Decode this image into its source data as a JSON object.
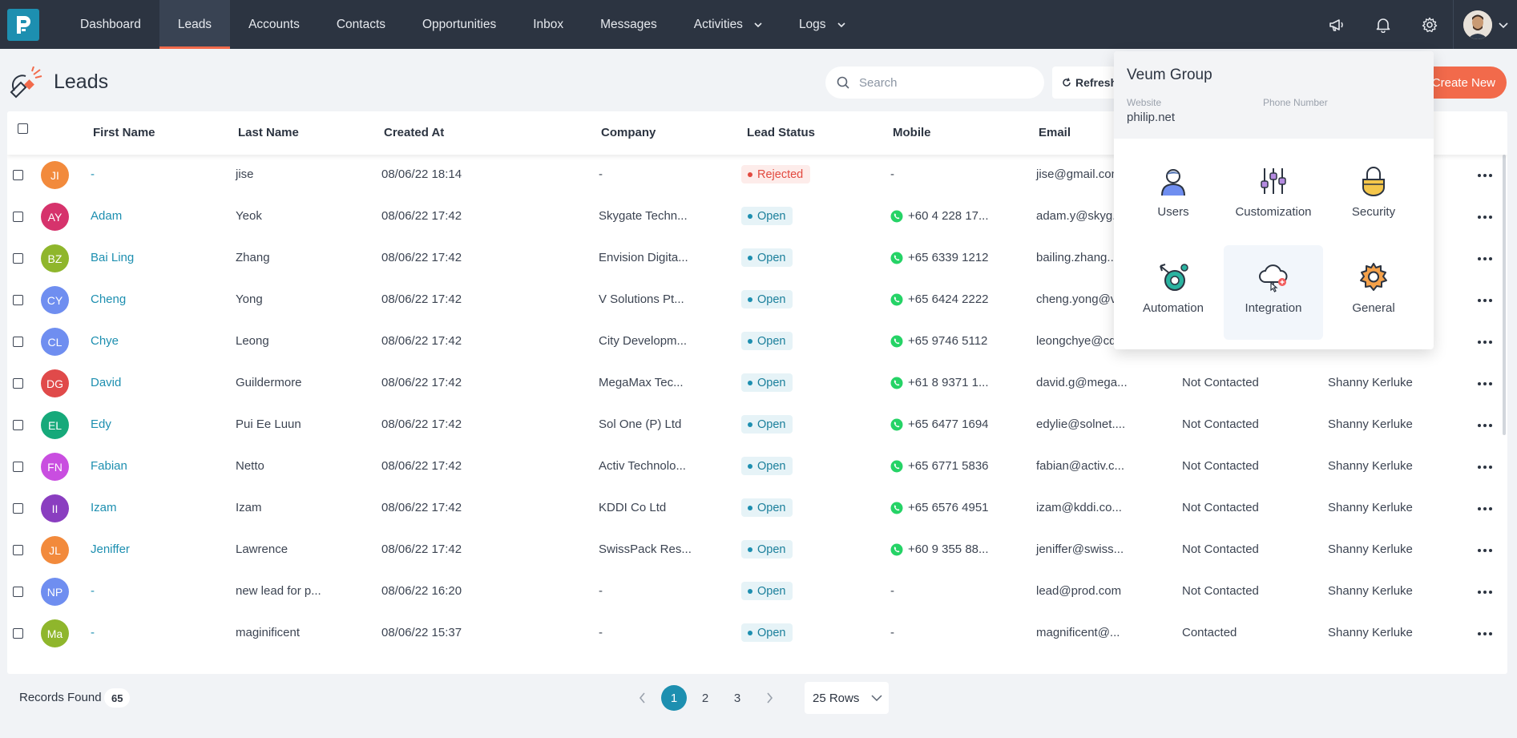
{
  "nav": {
    "items": [
      {
        "label": "Dashboard"
      },
      {
        "label": "Leads",
        "active": true
      },
      {
        "label": "Accounts"
      },
      {
        "label": "Contacts"
      },
      {
        "label": "Opportunities"
      },
      {
        "label": "Inbox"
      },
      {
        "label": "Messages"
      },
      {
        "label": "Activities",
        "dropdown": true
      },
      {
        "label": "Logs",
        "dropdown": true
      }
    ],
    "right_icons": [
      "megaphone-icon",
      "bell-icon",
      "gear-icon"
    ]
  },
  "page": {
    "title": "Leads",
    "search_placeholder": "Search",
    "search_value": "",
    "refresh_label": "Refresh",
    "create_label": "Create New"
  },
  "table": {
    "columns": [
      "First Name",
      "Last Name",
      "Created At",
      "Company",
      "Lead Status",
      "Mobile",
      "Email"
    ],
    "rows": [
      {
        "initials": "JI",
        "color": "#f28a3c",
        "first": "-",
        "last": "jise",
        "created": "08/06/22 18:14",
        "company": "-",
        "status": "Rejected",
        "mobile": "-",
        "wa": false,
        "email": "jise@gmail.com",
        "contact": "",
        "owner": ""
      },
      {
        "initials": "AY",
        "color": "#d6336c",
        "first": "Adam",
        "last": "Yeok",
        "created": "08/06/22 17:42",
        "company": "Skygate Techn...",
        "status": "Open",
        "mobile": "+60 4 228 17...",
        "wa": true,
        "email": "adam.y@skyg...",
        "contact": "",
        "owner": ""
      },
      {
        "initials": "BZ",
        "color": "#8fb62c",
        "first": "Bai Ling",
        "last": "Zhang",
        "created": "08/06/22 17:42",
        "company": "Envision Digita...",
        "status": "Open",
        "mobile": "+65 6339 1212",
        "wa": true,
        "email": "bailing.zhang...",
        "contact": "",
        "owner": ""
      },
      {
        "initials": "CY",
        "color": "#6f8ef0",
        "first": "Cheng",
        "last": "Yong",
        "created": "08/06/22 17:42",
        "company": "V Solutions Pt...",
        "status": "Open",
        "mobile": "+65 6424 2222",
        "wa": true,
        "email": "cheng.yong@v...",
        "contact": "",
        "owner": ""
      },
      {
        "initials": "CL",
        "color": "#6f8ef0",
        "first": "Chye",
        "last": "Leong",
        "created": "08/06/22 17:42",
        "company": "City Developm...",
        "status": "Open",
        "mobile": "+65 9746 5112",
        "wa": true,
        "email": "leongchye@cd...",
        "contact": "",
        "owner": ""
      },
      {
        "initials": "DG",
        "color": "#e04a4a",
        "first": "David",
        "last": "Guildermore",
        "created": "08/06/22 17:42",
        "company": "MegaMax Tec...",
        "status": "Open",
        "mobile": "+61 8 9371 1...",
        "wa": true,
        "email": "david.g@mega...",
        "contact": "Not Contacted",
        "owner": "Shanny Kerluke"
      },
      {
        "initials": "EL",
        "color": "#16a97a",
        "first": "Edy",
        "last": "Pui Ee Luun",
        "created": "08/06/22 17:42",
        "company": "Sol One (P) Ltd",
        "status": "Open",
        "mobile": "+65 6477 1694",
        "wa": true,
        "email": "edylie@solnet....",
        "contact": "Not Contacted",
        "owner": "Shanny Kerluke"
      },
      {
        "initials": "FN",
        "color": "#c94ee0",
        "first": "Fabian",
        "last": "Netto",
        "created": "08/06/22 17:42",
        "company": "Activ Technolo...",
        "status": "Open",
        "mobile": "+65 6771 5836",
        "wa": true,
        "email": "fabian@activ.c...",
        "contact": "Not Contacted",
        "owner": "Shanny Kerluke"
      },
      {
        "initials": "II",
        "color": "#8a3ec0",
        "first": "Izam",
        "last": "Izam",
        "created": "08/06/22 17:42",
        "company": "KDDI Co Ltd",
        "status": "Open",
        "mobile": "+65 6576 4951",
        "wa": true,
        "email": "izam@kddi.co...",
        "contact": "Not Contacted",
        "owner": "Shanny Kerluke"
      },
      {
        "initials": "JL",
        "color": "#f28a3c",
        "first": "Jeniffer",
        "last": "Lawrence",
        "created": "08/06/22 17:42",
        "company": "SwissPack Res...",
        "status": "Open",
        "mobile": "+60 9 355 88...",
        "wa": true,
        "email": "jeniffer@swiss...",
        "contact": "Not Contacted",
        "owner": "Shanny Kerluke"
      },
      {
        "initials": "NP",
        "color": "#6f8ef0",
        "first": "-",
        "last": "new lead for p...",
        "created": "08/06/22 16:20",
        "company": "-",
        "status": "Open",
        "mobile": "-",
        "wa": false,
        "email": "lead@prod.com",
        "contact": "Not Contacted",
        "owner": "Shanny Kerluke"
      },
      {
        "initials": "Ma",
        "color": "#8fb62c",
        "first": "-",
        "last": "maginificent",
        "created": "08/06/22 15:37",
        "company": "-",
        "status": "Open",
        "mobile": "-",
        "wa": false,
        "email": "magnificent@...",
        "contact": "Contacted",
        "owner": "Shanny Kerluke"
      }
    ]
  },
  "footer": {
    "records_label": "Records Found",
    "records_count": "65",
    "pages": [
      "1",
      "2",
      "3"
    ],
    "active_page": "1",
    "rows_label": "25 Rows"
  },
  "settings_menu": {
    "org_name": "Veum Group",
    "website_label": "Website",
    "website_value": "philip.net",
    "phone_label": "Phone Number",
    "phone_value": "",
    "tiles": [
      {
        "label": "Users",
        "icon": "users-icon"
      },
      {
        "label": "Customization",
        "icon": "customization-icon"
      },
      {
        "label": "Security",
        "icon": "security-icon"
      },
      {
        "label": "Automation",
        "icon": "automation-icon"
      },
      {
        "label": "Integration",
        "icon": "integration-icon"
      },
      {
        "label": "General",
        "icon": "general-icon"
      }
    ]
  },
  "colors": {
    "nav_bg": "#2c3441",
    "accent": "#1d8fb0",
    "brand_orange": "#f26a4b"
  }
}
